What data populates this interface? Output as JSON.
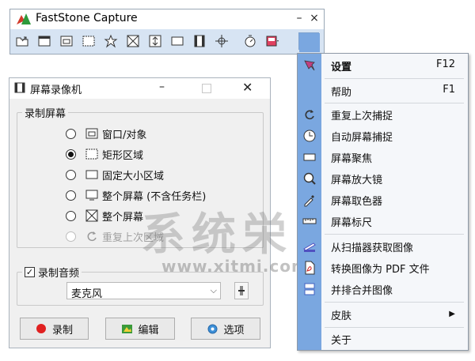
{
  "toolbar_window": {
    "title": "FastStone Capture",
    "min_glyph": "–",
    "close_glyph": "×",
    "buttons": [
      {
        "icon": "open-folder-icon"
      },
      {
        "icon": "capture-active-window-icon"
      },
      {
        "icon": "capture-window-object-icon"
      },
      {
        "icon": "capture-rectangle-icon"
      },
      {
        "icon": "capture-freehand-icon"
      },
      {
        "icon": "capture-full-screen-icon"
      },
      {
        "icon": "capture-scrolling-window-icon"
      },
      {
        "icon": "capture-fixed-region-icon"
      },
      {
        "icon": "screen-recorder-icon"
      },
      {
        "icon": "crosshair-icon"
      },
      {
        "icon": "timer-icon"
      },
      {
        "icon": "output-icon"
      },
      {
        "icon": "settings-menu-icon"
      }
    ]
  },
  "recorder_window": {
    "title": "屏幕录像机",
    "group_screen": {
      "legend": "录制屏幕",
      "options": [
        {
          "label": "窗口/对象",
          "selected": false,
          "disabled": false
        },
        {
          "label": "矩形区域",
          "selected": true,
          "disabled": false
        },
        {
          "label": "固定大小区域",
          "selected": false,
          "disabled": false
        },
        {
          "label": "整个屏幕 (不含任务栏)",
          "selected": false,
          "disabled": false
        },
        {
          "label": "整个屏幕",
          "selected": false,
          "disabled": false
        },
        {
          "label": "重复上次区域",
          "selected": false,
          "disabled": true
        }
      ]
    },
    "group_audio": {
      "legend": "录制音频",
      "checked": true,
      "device": "麦克风"
    },
    "buttons": {
      "record": "录制",
      "edit": "编辑",
      "options": "选项"
    }
  },
  "menu": {
    "items": [
      {
        "label": "设置",
        "shortcut": "F12",
        "bold": true,
        "icon": "settings-icon"
      },
      {
        "label": "帮助",
        "shortcut": "F1",
        "icon": ""
      },
      {
        "label": "重复上次捕捉",
        "shortcut": "",
        "icon": "repeat-icon"
      },
      {
        "label": "自动屏幕捕捉",
        "shortcut": "",
        "icon": "clock-icon"
      },
      {
        "label": "屏幕聚焦",
        "shortcut": "",
        "icon": "spotlight-icon"
      },
      {
        "label": "屏幕放大镜",
        "shortcut": "",
        "icon": "magnifier-icon"
      },
      {
        "label": "屏幕取色器",
        "shortcut": "",
        "icon": "color-picker-icon"
      },
      {
        "label": "屏幕标尺",
        "shortcut": "",
        "icon": "ruler-icon"
      },
      {
        "label": "从扫描器获取图像",
        "shortcut": "",
        "icon": "scanner-icon"
      },
      {
        "label": "转换图像为 PDF 文件",
        "shortcut": "",
        "icon": "pdf-icon"
      },
      {
        "label": "并排合并图像",
        "shortcut": "",
        "icon": "combine-images-icon"
      },
      {
        "label": "皮肤",
        "shortcut": "▶",
        "icon": ""
      },
      {
        "label": "关于",
        "shortcut": "",
        "icon": ""
      }
    ]
  },
  "watermark": {
    "text": "系统栄",
    "url": "www.xitmi.com"
  },
  "colors": {
    "toolbar_bg": "#d7e4f3",
    "menu_strip": "#7aa7e0",
    "record_dot": "#e02020"
  }
}
